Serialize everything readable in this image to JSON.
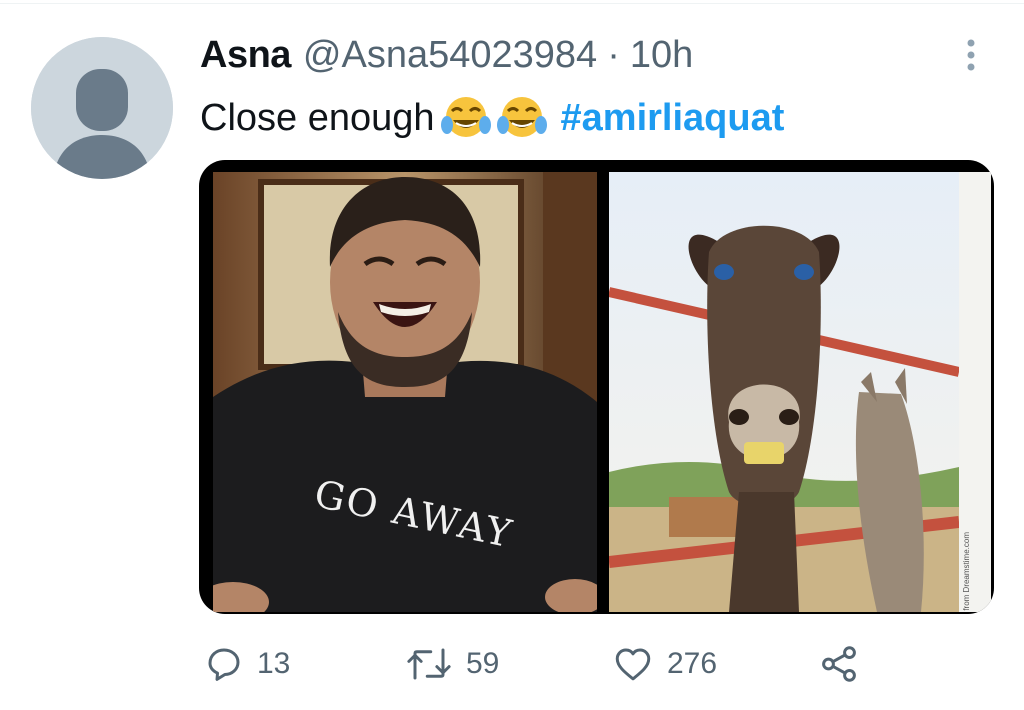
{
  "tweet": {
    "author_name": "Asna",
    "handle": "@Asna54023984",
    "separator": "·",
    "time": "10h",
    "text": "Close enough",
    "emojis": [
      "face-with-tears-of-joy-icon",
      "face-with-tears-of-joy-icon"
    ],
    "hashtag": "#amirliaquat",
    "media": {
      "left_image": {
        "shirt_text": "GO AWAY"
      },
      "right_image": {
        "strip_text": "Download from Dreamstime.com"
      }
    }
  },
  "actions": {
    "reply_count": "13",
    "retweet_count": "59",
    "like_count": "276"
  },
  "colors": {
    "accent": "#1d9bf0",
    "secondary_text": "#536471",
    "primary_text": "#0f1419"
  }
}
